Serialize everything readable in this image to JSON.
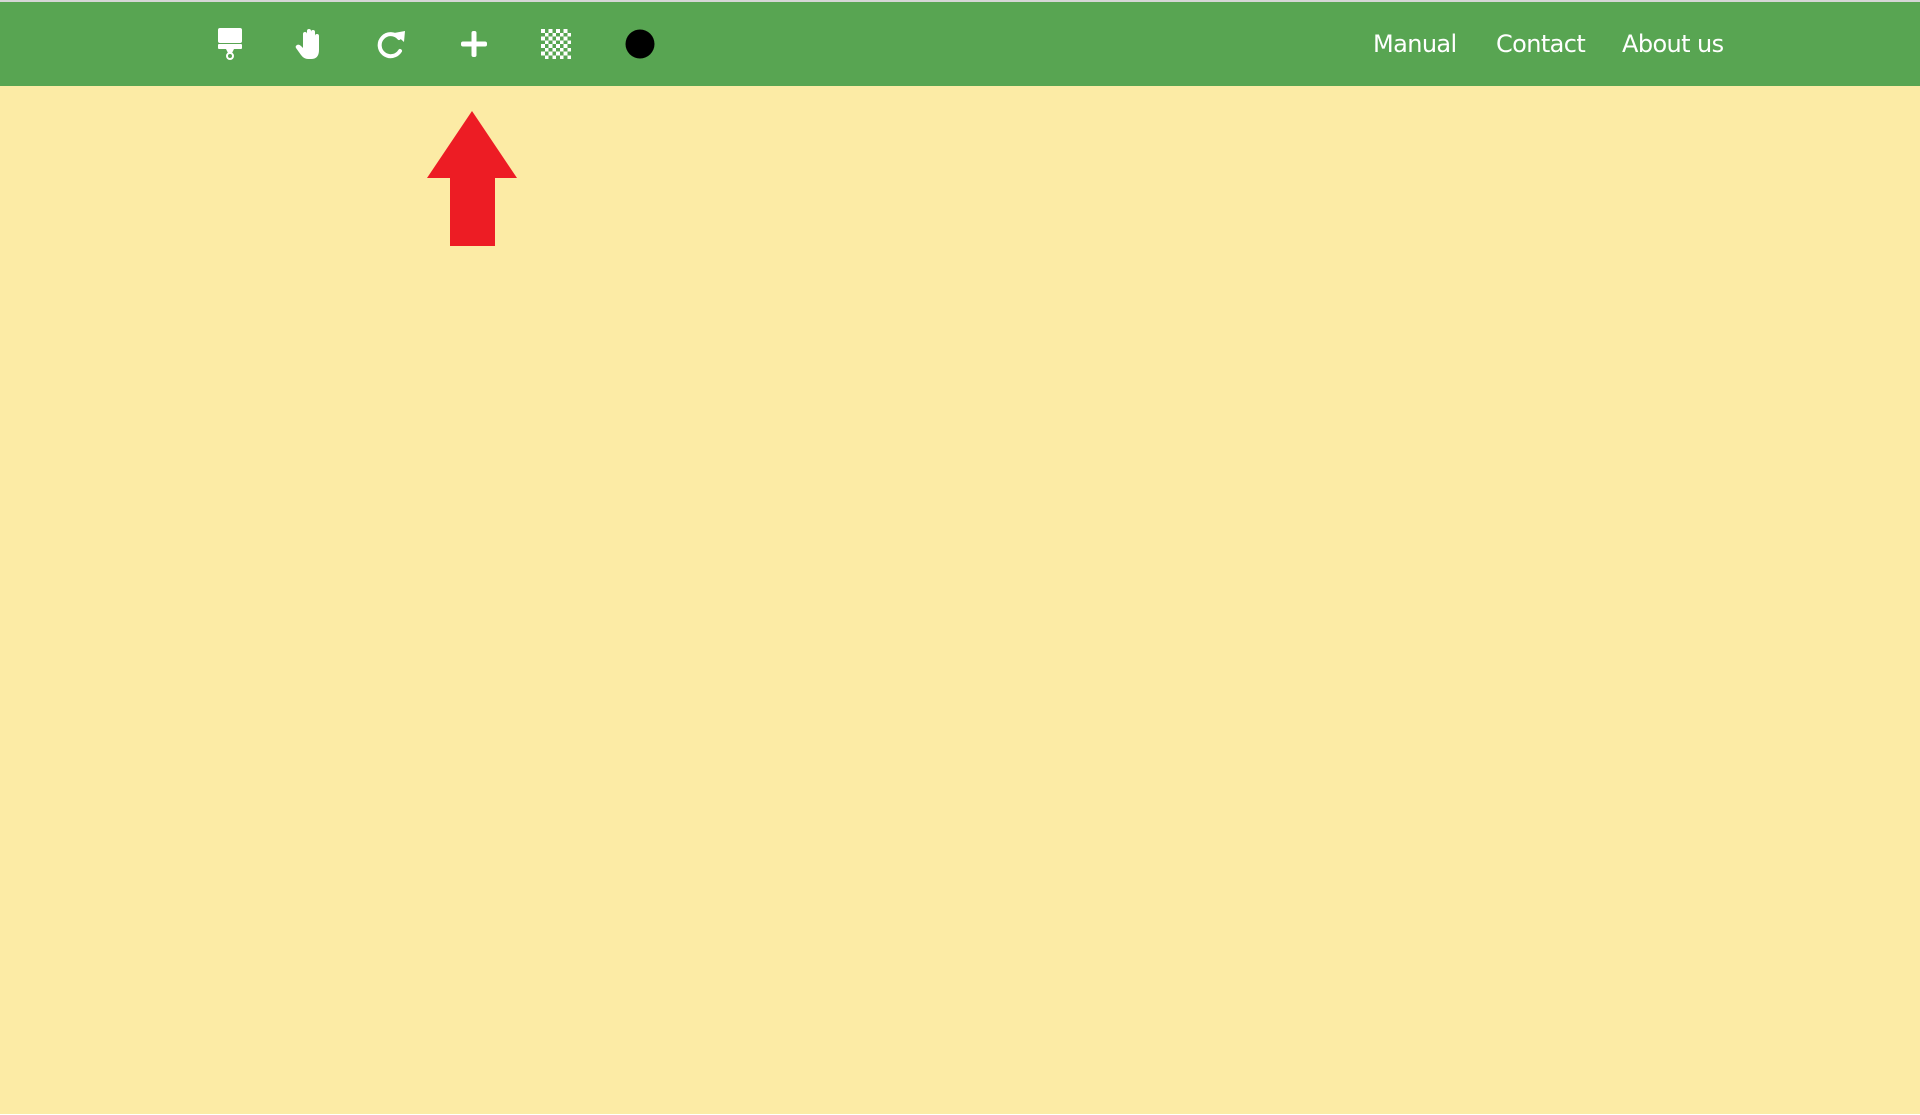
{
  "toolbar": {
    "tools": [
      {
        "name": "paint-brush",
        "icon": "paint-brush-icon",
        "label": "Brush"
      },
      {
        "name": "hand",
        "icon": "hand-icon",
        "label": "Pan"
      },
      {
        "name": "redo",
        "icon": "redo-icon",
        "label": "Redo"
      },
      {
        "name": "add",
        "icon": "plus-icon",
        "label": "Add"
      },
      {
        "name": "pattern",
        "icon": "checkerboard-icon",
        "label": "Pattern"
      },
      {
        "name": "color",
        "icon": "color-circle-icon",
        "label": "Color",
        "value": "#000000"
      }
    ]
  },
  "nav": {
    "manual": "Manual",
    "contact": "Contact",
    "about": "About us"
  },
  "annotation": {
    "icon": "arrow-up-icon",
    "points_to": "add",
    "color": "#ed1c24"
  },
  "colors": {
    "header": "#58a552",
    "background": "#fcebA5",
    "icon": "#ffffff"
  }
}
